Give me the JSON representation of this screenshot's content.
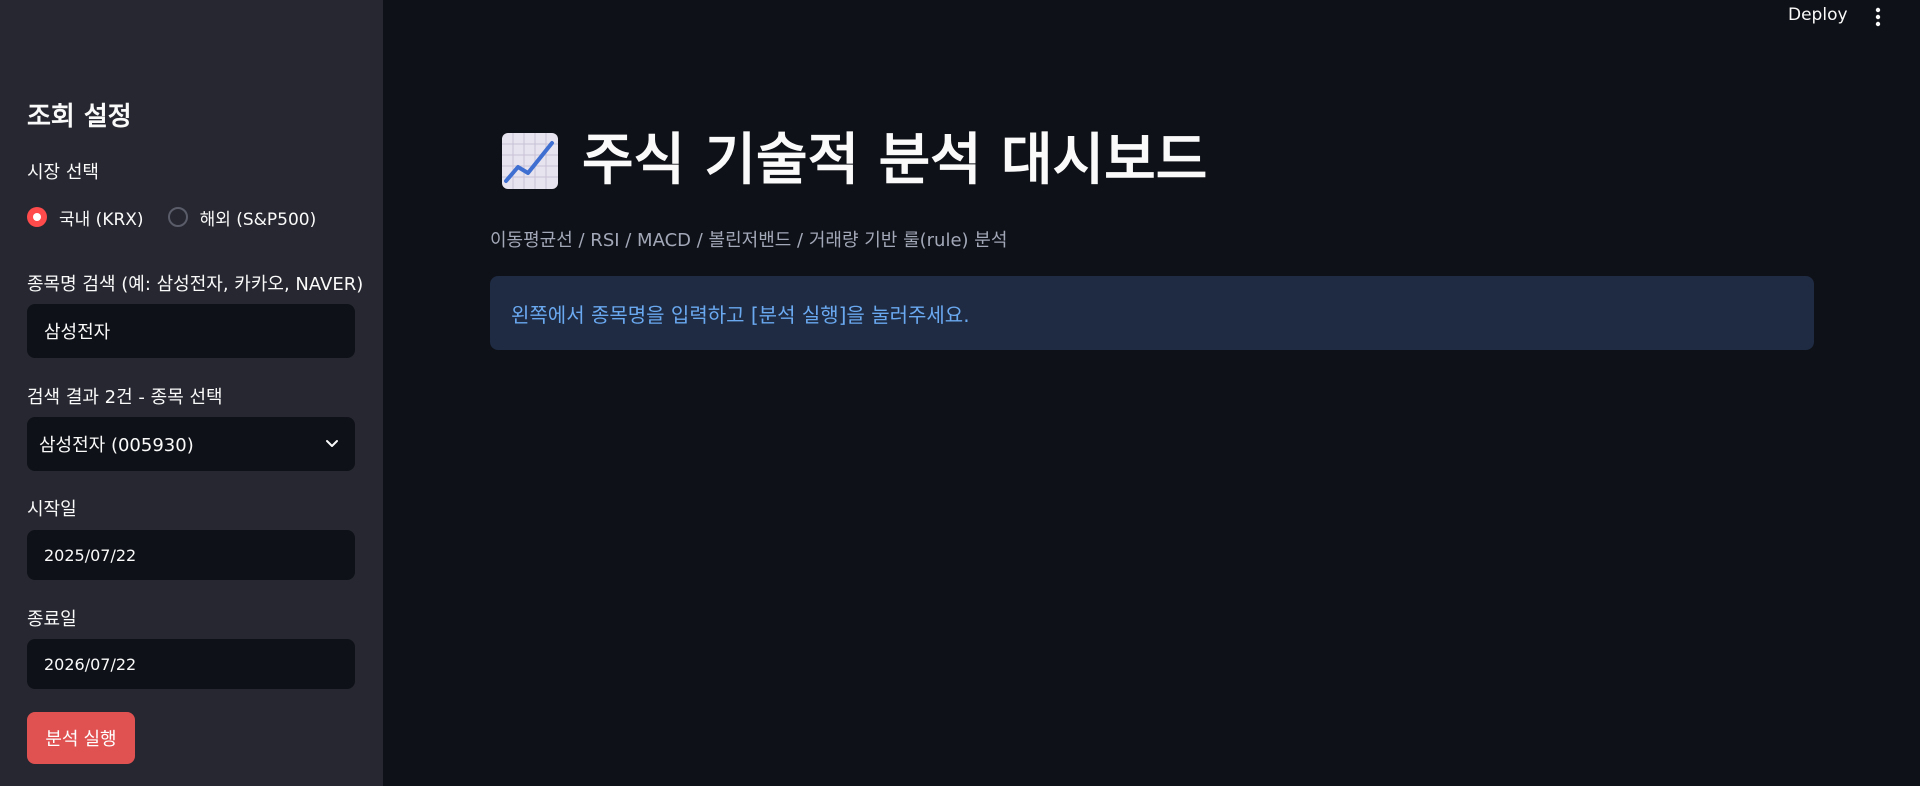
{
  "header": {
    "deploy_label": "Deploy",
    "menu_icon": "kebab-menu-icon"
  },
  "sidebar": {
    "title": "조회 설정",
    "market": {
      "label": "시장 선택",
      "options": [
        {
          "label": "국내 (KRX)",
          "selected": true
        },
        {
          "label": "해외 (S&P500)",
          "selected": false
        }
      ]
    },
    "search": {
      "label": "종목명 검색 (예: 삼성전자, 카카오, NAVER)",
      "value": "삼성전자"
    },
    "result": {
      "label": "검색 결과 2건 - 종목 선택",
      "selected": "삼성전자 (005930)"
    },
    "start_date": {
      "label": "시작일",
      "value": "2025/07/22"
    },
    "end_date": {
      "label": "종료일",
      "value": "2026/07/22"
    },
    "run_button": "분석 실행",
    "accent_color": "#ff4b4b"
  },
  "main": {
    "title_icon": "chart-increasing-icon",
    "title": "주식 기술적 분석 대시보드",
    "subtitle": "이동평균선 / RSI / MACD / 볼린저밴드 / 거래량 기반 룰(rule) 분석",
    "info_message": "왼쪽에서 종목명을 입력하고 [분석 실행]을 눌러주세요."
  }
}
